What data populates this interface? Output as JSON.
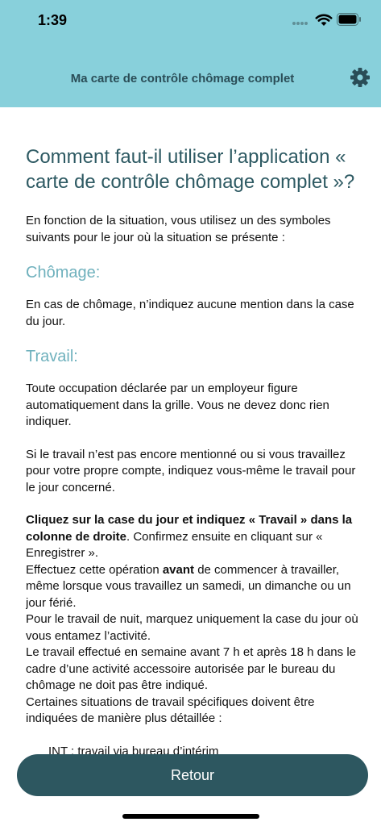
{
  "status": {
    "time": "1:39"
  },
  "nav": {
    "title": "Ma carte de contrôle chômage complet",
    "settings_icon": "gear-icon"
  },
  "colors": {
    "header_bg": "#88d0db",
    "title_text": "#2e5a63",
    "section_heading": "#6fb1bd",
    "button_bg": "#2d5760"
  },
  "content": {
    "title": "Comment faut-il utiliser l’application « carte de contrôle chômage complet »?",
    "intro": "En fonction de la situation, vous utilisez un des symboles suivants pour le jour où la situation se présente :",
    "chomage": {
      "heading": "Chômage:",
      "text": "En cas de chômage, n’indiquez aucune mention dans la case du jour."
    },
    "travail": {
      "heading": "Travail:",
      "p1": "Toute occupation déclarée par un employeur figure automatiquement dans la grille. Vous ne devez donc rien indiquer.",
      "p2": "Si le travail n’est pas encore mentionné ou si vous travaillez pour votre propre compte, indiquez vous-même le travail pour le jour concerné.",
      "p3_bold": "Cliquez sur la case du jour et indiquez « Travail » dans la colonne de droite",
      "p3_rest": ". Confirmez ensuite en cliquant sur « Enregistrer ».",
      "p4_pre": "Effectuez cette opération ",
      "p4_bold": "avant",
      "p4_post": " de commencer à travailler, même lorsque vous travaillez un samedi, un dimanche ou un jour férié.",
      "p5": "Pour le travail de nuit, marquez uniquement la case du jour où vous entamez l’activité.",
      "p6": "Le travail effectué en semaine avant 7 h et après 18 h dans le cadre d’une activité accessoire autorisée par le bureau du chômage ne doit pas être indiqué.",
      "p7": "Certaines situations de travail spécifiques doivent être indiquées de manière plus détaillée :",
      "p8": "INT : travail via bureau d’intérim"
    }
  },
  "footer": {
    "back_label": "Retour"
  }
}
